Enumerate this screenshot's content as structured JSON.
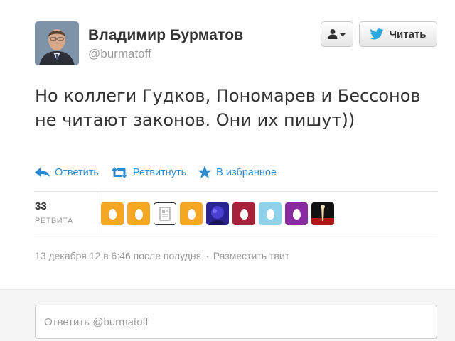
{
  "author": {
    "name": "Владимир Бурматов",
    "handle": "@burmatoff"
  },
  "buttons": {
    "follow_label": "Читать"
  },
  "tweet": {
    "text": "Но коллеги Гудков, Пономарев и Бессонов не читают законов. Они их пишут))"
  },
  "actions": {
    "reply": "Ответить",
    "retweet": "Ретвитнуть",
    "favorite": "В избранное"
  },
  "stats": {
    "retweet_count": "33",
    "retweet_label": "РЕТВИТА"
  },
  "retweeters": [
    {
      "kind": "egg",
      "bg": "#f5a623"
    },
    {
      "kind": "egg",
      "bg": "#f5a623"
    },
    {
      "kind": "doc",
      "bg": "#ffffff"
    },
    {
      "kind": "egg",
      "bg": "#f5a623"
    },
    {
      "kind": "photo-blue",
      "bg": "#3b2fa8"
    },
    {
      "kind": "egg",
      "bg": "#a8203a"
    },
    {
      "kind": "egg",
      "bg": "#8fd0ea"
    },
    {
      "kind": "egg",
      "bg": "#8a2aa0"
    },
    {
      "kind": "photo-dark",
      "bg": "#1a1a1a"
    }
  ],
  "meta": {
    "timestamp": "13 декабря 12 в 6:46 после полудня",
    "separator": "·",
    "embed_label": "Разместить твит"
  },
  "reply": {
    "placeholder": "Ответить @burmatoff"
  },
  "colors": {
    "link": "#2b8bd1",
    "twitter_blue": "#2aa9e0"
  }
}
